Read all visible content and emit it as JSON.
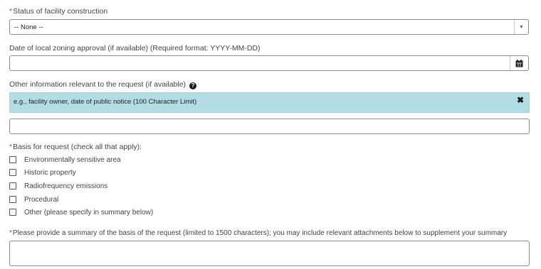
{
  "status_field": {
    "label": "Status of facility construction",
    "required_marker": "*",
    "selected": "-- None --"
  },
  "zoning_date_field": {
    "label": "Date of local zoning approval (if available) (Required format: YYYY-MM-DD)",
    "value": ""
  },
  "other_info_field": {
    "label": "Other information relevant to the request (if available)",
    "help_icon": "question-circle-icon",
    "hint_text": "e.g., facility owner, date of public notice (100 Character Limit)",
    "close_icon": "close-icon",
    "value": ""
  },
  "basis_field": {
    "required_marker": "*",
    "label": "Basis for request (check all that apply):",
    "options": [
      "Environmentally sensitive area",
      "Historic property",
      "Radiofrequency emissions",
      "Procedural",
      "Other (please specify in summary below)"
    ]
  },
  "summary_field": {
    "required_marker": "*",
    "label": "Please provide a summary of the basis of the request (limited to 1500 characters); you may include relevant attachments below to supplement your summary",
    "value": ""
  },
  "colors": {
    "banner_bg": "#b2dde5",
    "required": "#c23934",
    "border": "#8c8c8c"
  }
}
